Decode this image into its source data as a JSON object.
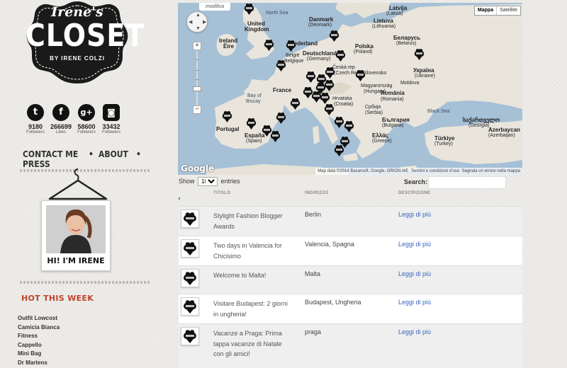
{
  "brand": {
    "script": "Irene's",
    "name": "CLOSET",
    "byline": "BY IRENE COLZI"
  },
  "socials": [
    {
      "icon": "twitter-icon",
      "glyph": "t",
      "count": "9180",
      "label": "Followers"
    },
    {
      "icon": "facebook-icon",
      "glyph": "f",
      "count": "266699",
      "label": "Likes"
    },
    {
      "icon": "google-plus-icon",
      "glyph": "g+",
      "count": "58600",
      "label": "Followers"
    },
    {
      "icon": "instagram-icon",
      "glyph": "◙",
      "count": "33432",
      "label": "Followers"
    }
  ],
  "nav": {
    "contact": "CONTACT ME",
    "about": "ABOUT",
    "press": "PRESS",
    "separator": "•"
  },
  "profile": {
    "caption": "HI! I'M IRENE"
  },
  "hot": {
    "title": "HOT THIS WEEK",
    "items": [
      "Outfit Lowcost",
      "Camicia Bianca",
      "Fitness",
      "Cappello",
      "Mini Bag",
      "Dr Martens"
    ]
  },
  "map": {
    "edit_tab": "modifica",
    "type_map": "Mappa",
    "type_satellite": "Satellite",
    "logo": "Google",
    "attribution": "Map data ©2014 Basarsoft, Google, ORION-ME",
    "terms": "Termini e condizioni d'uso",
    "report": "Segnala un errore nella mappa",
    "zoom_in": "+",
    "zoom_out": "−",
    "pin_text": "CLOSET",
    "labels": {
      "north_sea": "North Sea",
      "uk": "United",
      "uk2": "Kingdom",
      "ireland": "Ireland",
      "eire": "Éire",
      "bay": "Bay of",
      "bay2": "Biscay",
      "france": "France",
      "portugal": "Portugal",
      "spain": "España",
      "spain2": "(Spain)",
      "denmark": "Danmark",
      "denmark2": "(Denmark)",
      "netherlands": "Nederland",
      "belgium": "België",
      "belgium2": "Belgique",
      "germany": "Deutschland",
      "germany2": "(Germany)",
      "poland": "Polska",
      "poland2": "(Poland)",
      "czech": "Česká rep",
      "czech2": "(Czech Rep)",
      "slovakia": "Slovensko",
      "hungary": "Magyarország",
      "hungary2": "(Hungary)",
      "croatia": "Hrvatska",
      "croatia2": "(Croatia)",
      "serbia": "Србија",
      "serbia2": "(Serbia)",
      "romania": "România",
      "romania2": "(Romania)",
      "bulgaria": "България",
      "bulgaria2": "(Bulgaria)",
      "greece": "Ελλάς",
      "greece2": "(Greece)",
      "latvia": "Latvija",
      "latvia2": "(Latvia)",
      "lithuania": "Lietuva",
      "lithuania2": "(Lithuania)",
      "belarus": "Беларусь",
      "belarus2": "(Belarus)",
      "ukraine": "Україна",
      "ukraine2": "(Ukraine)",
      "moldova": "Moldova",
      "black_sea": "Black Sea",
      "georgia": "საქართველო",
      "georgia2": "(Georgia)",
      "turkey": "Türkiye",
      "turkey2": "(Turkey)",
      "azerbaijan": "Azerbaycan",
      "azerbaijan2": "(Azerbaijan)"
    }
  },
  "table": {
    "show_label": "Show",
    "show_value": "10",
    "entries_label": "entries",
    "search_label": "Search:",
    "search_value": "",
    "columns": {
      "titolo": "TITOLO",
      "indirizzo": "INDIRIZZO",
      "descrizione": "DESCRIZIONE"
    },
    "rows": [
      {
        "title": "Stylight Fashion Blogger Awards",
        "address": "Berlin",
        "link": "Leggi di più"
      },
      {
        "title": "Two days in Valencia for Chicisimo",
        "address": "Valencia, Spagna",
        "link": "Leggi di più"
      },
      {
        "title": "Welcome to Malta!",
        "address": "Malta",
        "link": "Leggi di più"
      },
      {
        "title": "Visitare Budapest: 2 giorni in ungheria!",
        "address": "Budapest, Ungheria",
        "link": "Leggi di più"
      },
      {
        "title": "Vacanze a Praga: Prima tappa vacanze di Natale con gli amici!",
        "address": "praga",
        "link": "Leggi di più"
      }
    ]
  },
  "colors": {
    "accent_red": "#c0442c",
    "link_blue": "#3b65b8",
    "sea": "#a6c0d6",
    "land": "#e9e5dc"
  }
}
